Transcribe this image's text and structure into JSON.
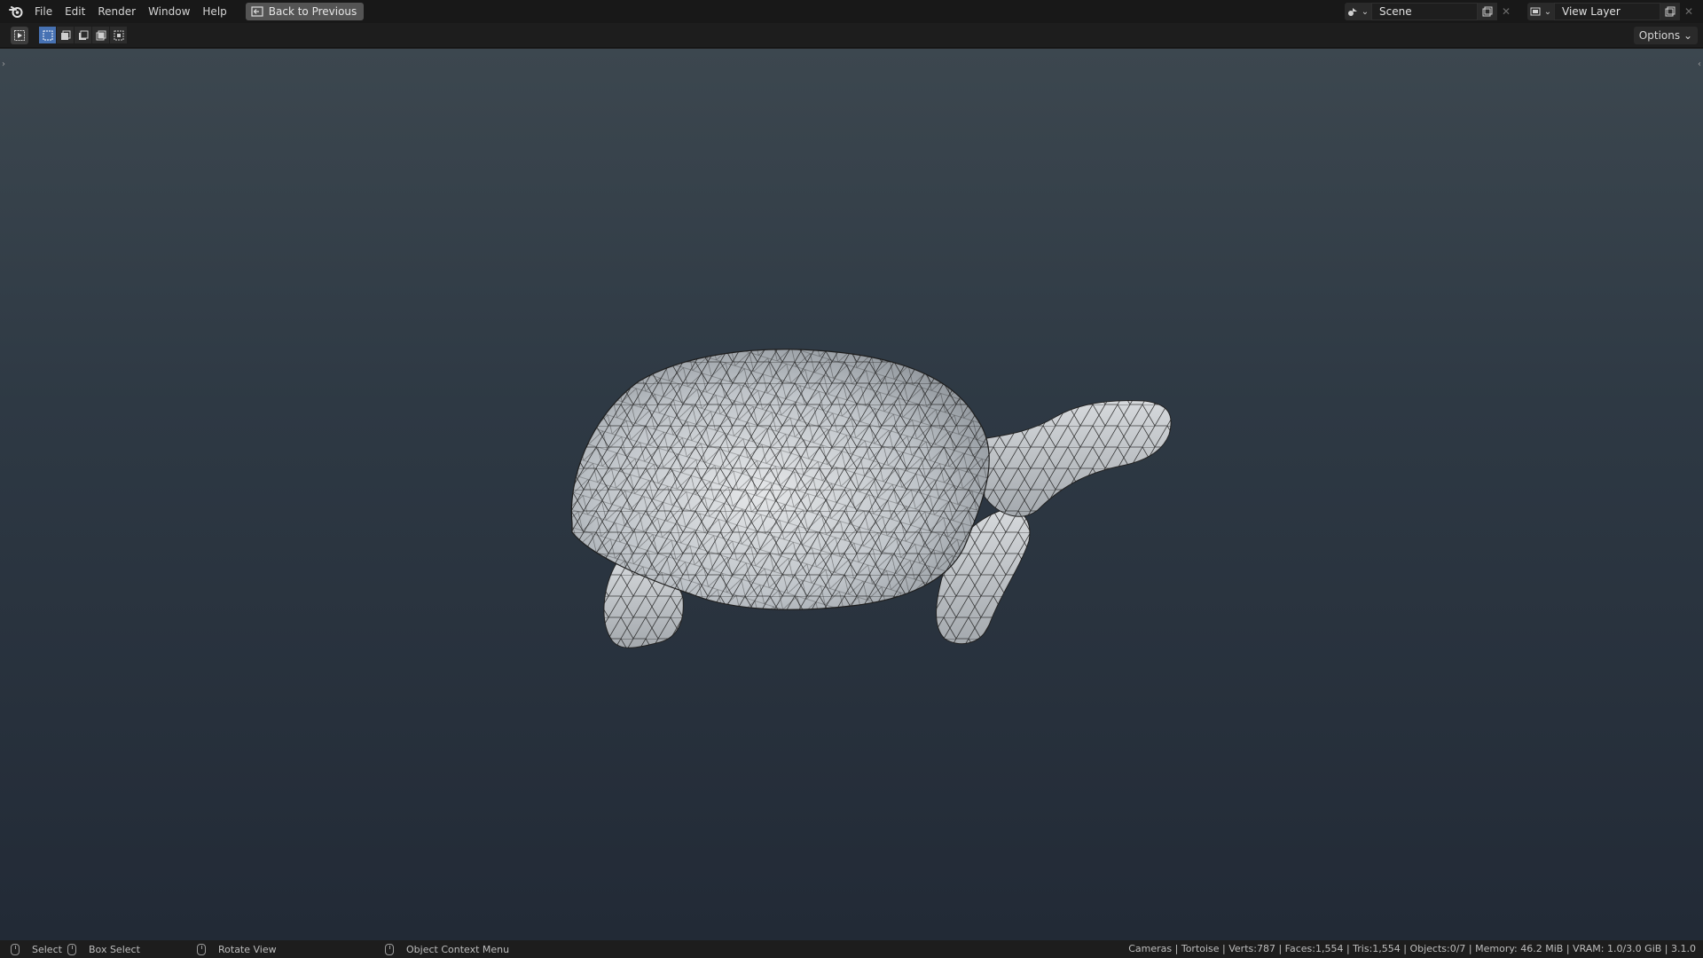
{
  "app": {
    "brand_color": "#4772b3"
  },
  "topbar": {
    "logo_icon": "blender-logo-icon",
    "menus": [
      "File",
      "Edit",
      "Render",
      "Window",
      "Help"
    ],
    "back_button": {
      "icon": "back-arrow-icon",
      "label": "Back to Previous"
    },
    "scene": {
      "icon": "scene-icon",
      "value": "Scene"
    },
    "view_layer": {
      "icon": "view-layer-icon",
      "value": "View Layer"
    }
  },
  "toolheader": {
    "tool_icon": "select-cursor-icon",
    "mode_icons": [
      "select-new-icon",
      "select-extend-icon",
      "select-subtract-icon",
      "select-invert-icon",
      "select-intersect-icon"
    ],
    "active_mode_index": 0,
    "options_label": "Options"
  },
  "viewport": {
    "object": "tortoise-mesh",
    "shading": "solid-wireframe"
  },
  "statusbar": {
    "hints": [
      {
        "icon": "mouse-left-icon",
        "label": "Select"
      },
      {
        "icon": "mouse-left-drag-icon",
        "label": "Box Select"
      },
      {
        "icon": "mouse-middle-icon",
        "label": "Rotate View"
      },
      {
        "icon": "mouse-right-icon",
        "label": "Object Context Menu"
      }
    ],
    "stats": "Cameras | Tortoise | Verts:787 | Faces:1,554 | Tris:1,554 | Objects:0/7 | Memory: 46.2 MiB | VRAM: 1.0/3.0 GiB | 3.1.0"
  }
}
